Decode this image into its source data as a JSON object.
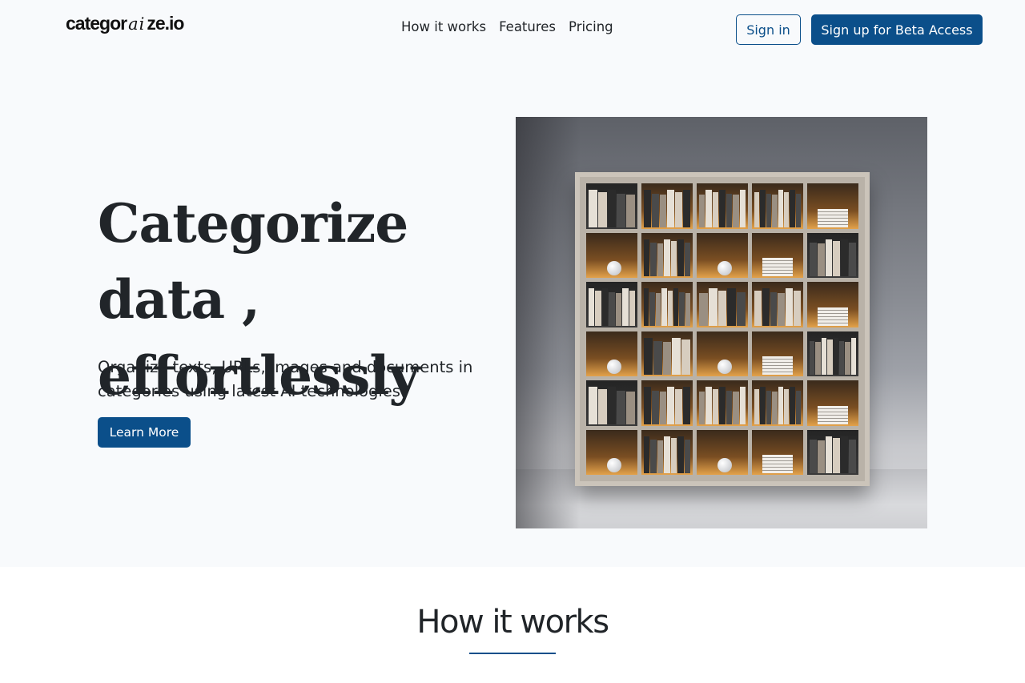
{
  "header": {
    "logo": {
      "part1": "categor",
      "part2": "ai",
      "part3": "ze.io"
    },
    "nav": [
      "How it works",
      "Features",
      "Pricing"
    ],
    "sign_in": "Sign in",
    "sign_up": "Sign up for Beta Access"
  },
  "hero": {
    "title_line1": "Categorize data ,",
    "title_line2": "effortlessly",
    "subtitle": "Organize texts, URLs, images and documents in categories using latest AI technologies",
    "cta": "Learn More",
    "image_alt": "bookshelf-illustration"
  },
  "how_it_works": {
    "title": "How it works"
  },
  "colors": {
    "brand": "#0b4f8a",
    "page_bg": "#f8fafc",
    "text": "#212529"
  }
}
